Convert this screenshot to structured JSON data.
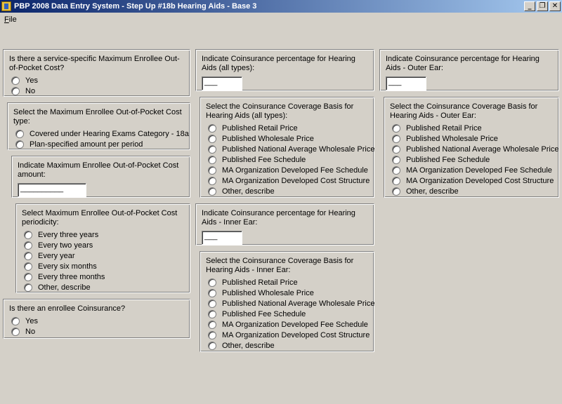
{
  "window": {
    "title": "PBP 2008 Data Entry System - Step Up #18b Hearing Aids - Base 3",
    "min_label": "_",
    "restore_label": "❐",
    "close_label": "✕"
  },
  "menu": {
    "file_accel": "F",
    "file_rest": "ile"
  },
  "left": {
    "max_oop_q": {
      "question": "Is there a service-specific Maximum Enrollee Out-of-Pocket Cost?",
      "options": [
        "Yes",
        "No"
      ]
    },
    "max_oop_type": {
      "question": "Select the Maximum Enrollee Out-of-Pocket Cost type:",
      "options": [
        "Covered under Hearing Exams Category - 18a",
        "Plan-specified amount per period"
      ]
    },
    "max_oop_amount": {
      "question": "Indicate Maximum Enrollee Out-of-Pocket Cost amount:",
      "value": "__________"
    },
    "max_oop_period": {
      "question": "Select Maximum Enrollee Out-of-Pocket Cost periodicity:",
      "options": [
        "Every three years",
        "Every two years",
        "Every year",
        "Every six months",
        "Every three months",
        "Other, describe"
      ]
    },
    "coinsurance_q": {
      "question": "Is there an enrollee Coinsurance?",
      "options": [
        "Yes",
        "No"
      ]
    }
  },
  "middle": {
    "coins_all": {
      "question": "Indicate Coinsurance percentage for Hearing Aids (all types):",
      "value": "___"
    },
    "basis_all": {
      "question": "Select the Coinsurance Coverage Basis for Hearing Aids (all types):",
      "options": [
        "Published Retail Price",
        "Published Wholesale Price",
        "Published National Average Wholesale Price",
        "Published Fee Schedule",
        "MA Organization Developed Fee Schedule",
        "MA Organization Developed Cost Structure",
        "Other, describe"
      ]
    },
    "coins_inner": {
      "question": "Indicate Coinsurance percentage for Hearing Aids - Inner Ear:",
      "value": "___"
    },
    "basis_inner": {
      "question": "Select the Coinsurance Coverage Basis for Hearing Aids - Inner Ear:",
      "options": [
        "Published Retail Price",
        "Published Wholesale Price",
        "Published National Average Wholesale Price",
        "Published Fee Schedule",
        "MA Organization Developed Fee Schedule",
        "MA Organization Developed Cost Structure",
        "Other, describe"
      ]
    }
  },
  "right": {
    "coins_outer": {
      "question": "Indicate Coinsurance percentage for Hearing Aids - Outer Ear:",
      "value": "___"
    },
    "basis_outer": {
      "question": "Select the Coinsurance Coverage Basis for Hearing Aids - Outer Ear:",
      "options": [
        "Published Retail Price",
        "Published Wholesale Price",
        "Published National Average Wholesale Price",
        "Published Fee Schedule",
        "MA Organization Developed Fee Schedule",
        "MA Organization Developed Cost Structure",
        "Other, describe"
      ]
    }
  }
}
